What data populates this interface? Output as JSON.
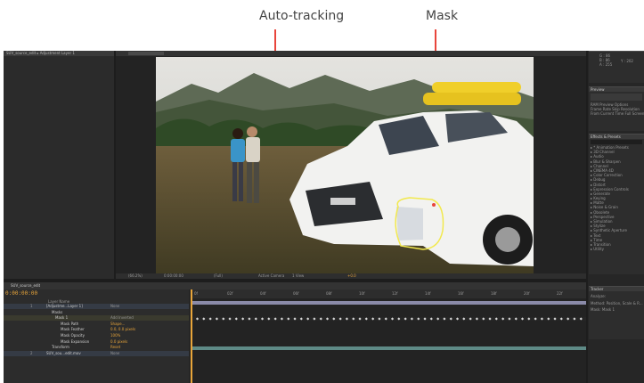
{
  "callouts": {
    "auto_tracking": "Auto-tracking",
    "mask": "Mask"
  },
  "colors": {
    "accent_line": "#e8453c",
    "timecode": "#e8a53a",
    "mask_outline": "#f2e94e"
  },
  "app": {
    "project_tab": "SUV_source_edit ▸ Adjustment Layer 1",
    "info_values": [
      "G : 86",
      "B : 86",
      "A : 255",
      "Y : 202"
    ],
    "comp_toolbar": [
      "(66.2%)",
      "0:00:00:00",
      "(Full)",
      "Active Camera",
      "1 View",
      "+0.0"
    ]
  },
  "right_panels": {
    "preview": {
      "title": "Preview",
      "labels": [
        "RAM Preview Options",
        "Frame Rate  Skip  Resolution",
        "From Current Time   Full Screen"
      ]
    },
    "effects": {
      "title": "Effects & Presets",
      "items": [
        "* Animation Presets",
        "3D Channel",
        "Audio",
        "Blur & Sharpen",
        "Channel",
        "CINEMA 4D",
        "Color Correction",
        "Debug",
        "Distort",
        "Expression Controls",
        "Generate",
        "Keying",
        "Matte",
        "Noise & Grain",
        "Obsolete",
        "Perspective",
        "Simulation",
        "Stylize",
        "Synthetic Aperture",
        "Text",
        "Time",
        "Transition",
        "Utility"
      ]
    },
    "tracker": {
      "title": "Tracker",
      "analyze": "Analyze:",
      "method": "Method:  Position, Scale & R...",
      "mask": "Mask:  Mask 1"
    }
  },
  "timeline": {
    "tab": "SUV_source_edit",
    "timecode": "0:00:00:00",
    "layer_col": "Layer Name",
    "rows": [
      {
        "num": "1",
        "name": "[Adjustme...Layer 1]",
        "mode": "None"
      },
      {
        "num": "",
        "name": "Masks",
        "mode": ""
      },
      {
        "num": "",
        "name": "Mask 1",
        "mode": "Add   Inverted"
      },
      {
        "num": "",
        "name": "Mask Path",
        "mode": "Shape..."
      },
      {
        "num": "",
        "name": "Mask Feather",
        "mode": "0.0, 0.0 pixels"
      },
      {
        "num": "",
        "name": "Mask Opacity",
        "mode": "100%"
      },
      {
        "num": "",
        "name": "Mask Expansion",
        "mode": "0.0 pixels"
      },
      {
        "num": "",
        "name": "Transform",
        "mode": "Reset"
      },
      {
        "num": "2",
        "name": "SUV_sou...edit.mov",
        "mode": "None"
      }
    ],
    "ruler": [
      "0f",
      "02f",
      "04f",
      "06f",
      "08f",
      "10f",
      "12f",
      "14f",
      "16f",
      "18f",
      "20f",
      "22f"
    ]
  }
}
